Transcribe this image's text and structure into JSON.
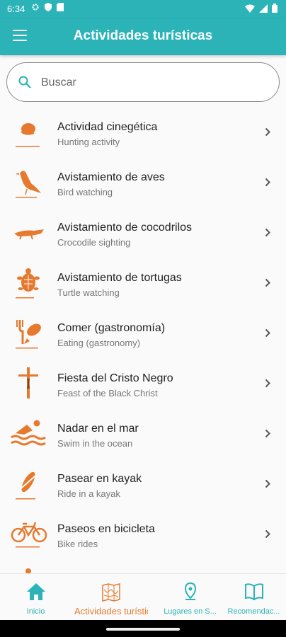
{
  "status": {
    "time": "6:34"
  },
  "appbar": {
    "title": "Actividades turísticas"
  },
  "search": {
    "placeholder": "Buscar"
  },
  "items": [
    {
      "title": "Actividad cinegética",
      "subtitle": "Hunting activity",
      "icon": "hunting-icon"
    },
    {
      "title": "Avistamiento de aves",
      "subtitle": "Bird watching",
      "icon": "bird-icon"
    },
    {
      "title": "Avistamiento de cocodrilos",
      "subtitle": "Crocodile sighting",
      "icon": "crocodile-icon"
    },
    {
      "title": "Avistamiento de tortugas",
      "subtitle": "Turtle watching",
      "icon": "turtle-icon"
    },
    {
      "title": "Comer (gastronomía)",
      "subtitle": "Eating (gastronomy)",
      "icon": "food-icon"
    },
    {
      "title": "Fiesta del Cristo Negro",
      "subtitle": "Feast of the Black Christ",
      "icon": "cross-icon"
    },
    {
      "title": "Nadar en el mar",
      "subtitle": "Swim in the ocean",
      "icon": "swimming-icon"
    },
    {
      "title": "Pasear en kayak",
      "subtitle": "Ride in a kayak",
      "icon": "kayak-icon"
    },
    {
      "title": "Paseos en bicicleta",
      "subtitle": "Bike rides",
      "icon": "bicycle-icon"
    }
  ],
  "nav": [
    {
      "label": "Inicio",
      "icon": "home-icon"
    },
    {
      "label": "Actividades turísticas",
      "icon": "map-icon"
    },
    {
      "label": "Lugares en S...",
      "icon": "location-pin-icon"
    },
    {
      "label": "Recomendac...",
      "icon": "book-icon"
    }
  ],
  "colors": {
    "primary": "#2bb3b8",
    "accent": "#e57a2f"
  }
}
